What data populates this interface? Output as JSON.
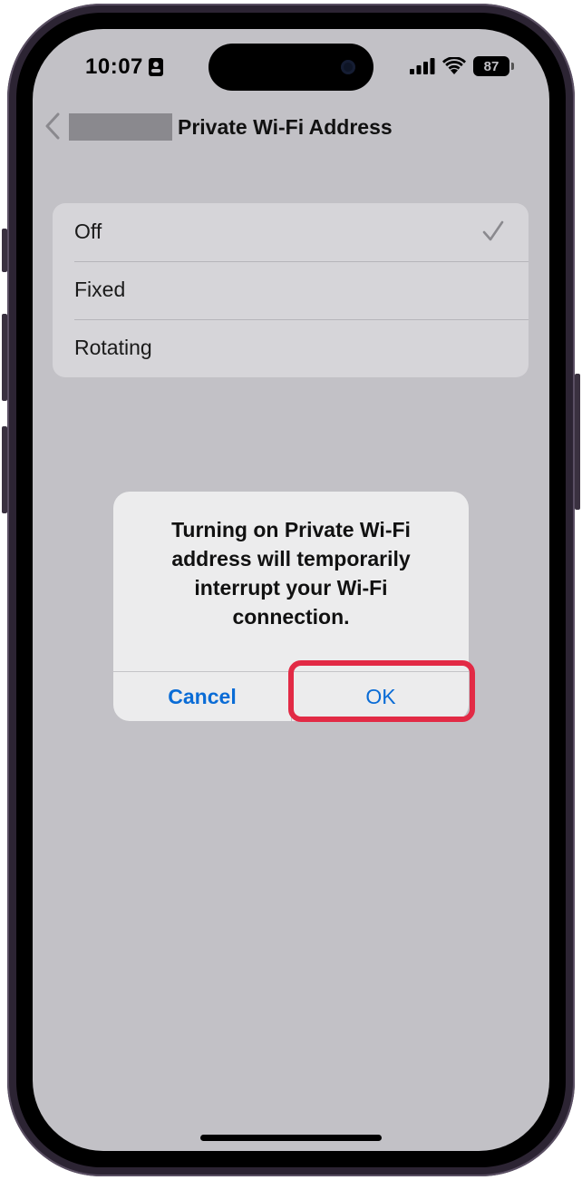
{
  "status_bar": {
    "time": "10:07",
    "battery": "87",
    "icons": [
      "id-card-icon",
      "cellular-signal-icon",
      "wifi-icon",
      "battery-icon"
    ]
  },
  "nav": {
    "back_label": "",
    "title": "Private Wi-Fi Address"
  },
  "options": {
    "items": [
      {
        "label": "Off",
        "selected": true
      },
      {
        "label": "Fixed",
        "selected": false
      },
      {
        "label": "Rotating",
        "selected": false
      }
    ]
  },
  "alert": {
    "message": "Turning on Private Wi-Fi address will temporarily interrupt your Wi-Fi connection.",
    "cancel_label": "Cancel",
    "ok_label": "OK"
  },
  "colors": {
    "accent": "#0a6cd6",
    "highlight": "#e22a45",
    "dimmed_background": "#c2c1c6"
  }
}
